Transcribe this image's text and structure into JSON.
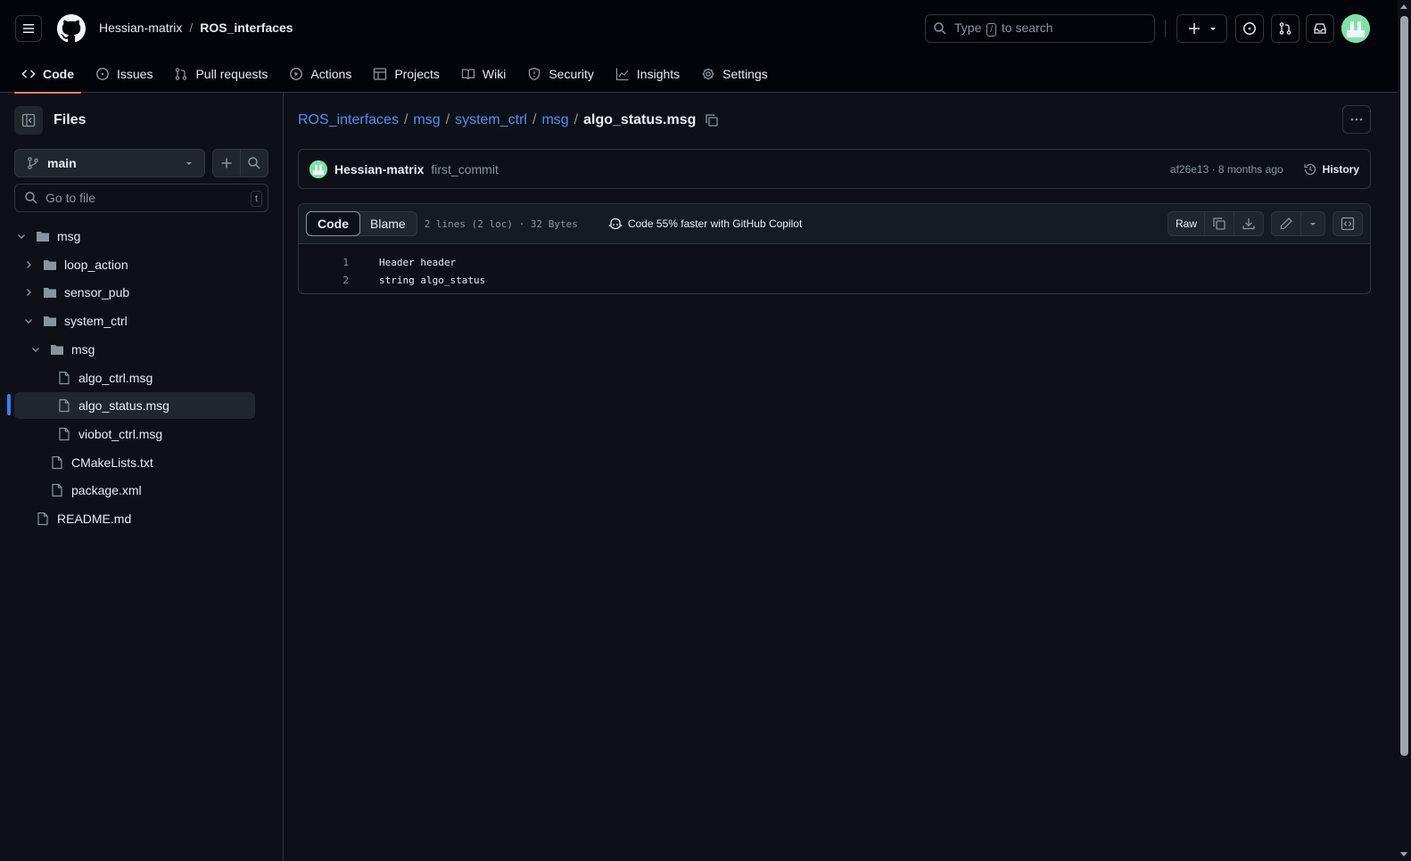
{
  "header": {
    "owner": "Hessian-matrix",
    "separator": "/",
    "repo": "ROS_interfaces",
    "search_pre": "Type",
    "search_key": "/",
    "search_post": "to search"
  },
  "tabs": [
    {
      "label": "Code",
      "icon": "code-icon",
      "active": true
    },
    {
      "label": "Issues",
      "icon": "issue-icon"
    },
    {
      "label": "Pull requests",
      "icon": "pull-request-icon"
    },
    {
      "label": "Actions",
      "icon": "play-icon"
    },
    {
      "label": "Projects",
      "icon": "table-icon"
    },
    {
      "label": "Wiki",
      "icon": "book-icon"
    },
    {
      "label": "Security",
      "icon": "shield-icon"
    },
    {
      "label": "Insights",
      "icon": "graph-icon"
    },
    {
      "label": "Settings",
      "icon": "gear-icon"
    }
  ],
  "sidebar": {
    "title": "Files",
    "branch": "main",
    "go_to_file": "Go to file",
    "go_to_file_key": "t",
    "tree": [
      {
        "name": "msg",
        "type": "folder",
        "open": true
      },
      {
        "name": "loop_action",
        "type": "folder",
        "open": false
      },
      {
        "name": "sensor_pub",
        "type": "folder",
        "open": false
      },
      {
        "name": "system_ctrl",
        "type": "folder",
        "open": true
      },
      {
        "name": "msg",
        "type": "folder",
        "open": true
      },
      {
        "name": "algo_ctrl.msg",
        "type": "file"
      },
      {
        "name": "algo_status.msg",
        "type": "file",
        "selected": true
      },
      {
        "name": "viobot_ctrl.msg",
        "type": "file"
      },
      {
        "name": "CMakeLists.txt",
        "type": "file"
      },
      {
        "name": "package.xml",
        "type": "file"
      },
      {
        "name": "README.md",
        "type": "file"
      }
    ]
  },
  "breadcrumb": {
    "links": [
      "ROS_interfaces",
      "msg",
      "system_ctrl",
      "msg"
    ],
    "separator": "/",
    "current": "algo_status.msg"
  },
  "commit": {
    "author": "Hessian-matrix",
    "message": "first_commit",
    "sha_time": "af26e13 · 8 months ago",
    "history": "History"
  },
  "viewer": {
    "tab_code": "Code",
    "tab_blame": "Blame",
    "meta": "2 lines (2 loc) · 32 Bytes",
    "copilot": "Code 55% faster with GitHub Copilot",
    "raw": "Raw",
    "lines": [
      {
        "n": "1",
        "text": "Header header"
      },
      {
        "n": "2",
        "text": "string algo_status"
      }
    ]
  },
  "colors": {
    "accent_link": "#4493f8",
    "tab_underline": "#f78166",
    "selected_bar": "#2f81f7",
    "background": "#0d1117",
    "header_bg": "#010409"
  }
}
